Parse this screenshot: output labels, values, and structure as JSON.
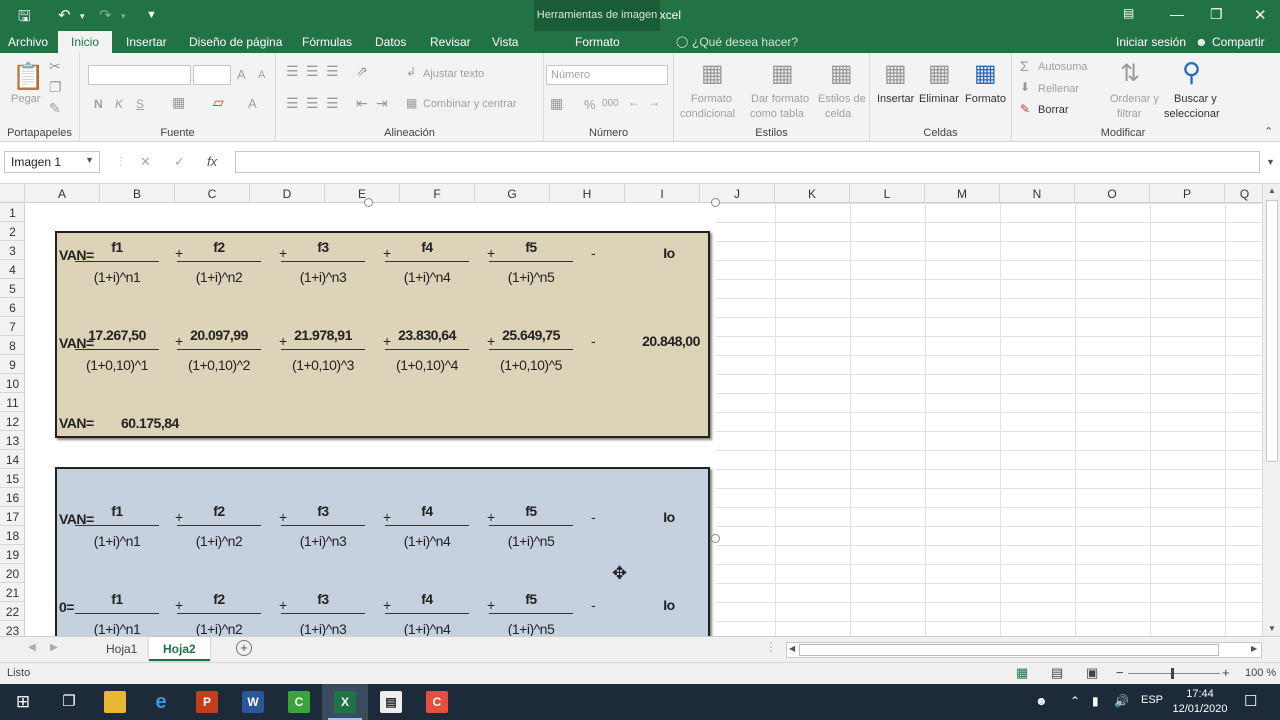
{
  "window": {
    "title": "van y tir - Excel",
    "tools_context": "Herramientas de imagen",
    "undo_icon": "undo-icon",
    "colors": {
      "brand": "#217346"
    }
  },
  "tabs": {
    "items": [
      "Archivo",
      "Inicio",
      "Insertar",
      "Diseño de página",
      "Fórmulas",
      "Datos",
      "Revisar",
      "Vista"
    ],
    "format_tab": "Formato",
    "tell_me": "¿Qué desea hacer?",
    "sign_in": "Iniciar sesión",
    "share": "Compartir"
  },
  "ribbon": {
    "clipboard": {
      "label": "Portapapeles",
      "paste": "Pegar"
    },
    "font": {
      "label": "Fuente",
      "bold": "N",
      "italic": "K",
      "underline": "S",
      "grow": "A",
      "shrink": "A"
    },
    "alignment": {
      "label": "Alineación",
      "wrap": "Ajustar texto",
      "merge": "Combinar y centrar"
    },
    "number": {
      "label": "Número",
      "format": "Número",
      "percent": "%",
      "thousands": "000"
    },
    "styles": {
      "label": "Estilos",
      "conditional_1": "Formato",
      "conditional_2": "condicional",
      "table_1": "Dar formato",
      "table_2": "como tabla",
      "cell_1": "Estilos de",
      "cell_2": "celda"
    },
    "cells": {
      "label": "Celdas",
      "insert": "Insertar",
      "delete": "Eliminar",
      "format": "Formato"
    },
    "editing": {
      "label": "Modificar",
      "autosum": "Autosuma",
      "fill": "Rellenar",
      "clear": "Borrar",
      "sort_1": "Ordenar y",
      "sort_2": "filtrar",
      "find_1": "Buscar y",
      "find_2": "seleccionar"
    }
  },
  "formula_bar": {
    "name_box": "Imagen 1",
    "fx": "fx",
    "cancel": "✕",
    "enter": "✓",
    "value": ""
  },
  "columns": [
    "A",
    "B",
    "C",
    "D",
    "E",
    "F",
    "G",
    "H",
    "I",
    "J",
    "K",
    "L",
    "M",
    "N",
    "O",
    "P",
    "Q"
  ],
  "rows": [
    "1",
    "2",
    "3",
    "4",
    "5",
    "6",
    "7",
    "8",
    "9",
    "10",
    "11",
    "12",
    "13",
    "14",
    "15",
    "16",
    "17",
    "18",
    "19",
    "20",
    "21",
    "22",
    "23"
  ],
  "image": {
    "box1": {
      "row1": {
        "lhs": "VAN=",
        "nums": [
          "f1",
          "f2",
          "f3",
          "f4",
          "f5"
        ],
        "dens": [
          "(1+i)^n1",
          "(1+i)^n2",
          "(1+i)^n3",
          "(1+i)^n4",
          "(1+i)^n5"
        ],
        "ops": [
          "+",
          "+",
          "+",
          "+",
          "-"
        ],
        "io": "Io"
      },
      "row2": {
        "lhs": "VAN=",
        "nums": [
          "17.267,50",
          "20.097,99",
          "21.978,91",
          "23.830,64",
          "25.649,75"
        ],
        "dens": [
          "(1+0,10)^1",
          "(1+0,10)^2",
          "(1+0,10)^3",
          "(1+0,10)^4",
          "(1+0,10)^5"
        ],
        "ops": [
          "+",
          "+",
          "+",
          "+",
          "-"
        ],
        "io": "20.848,00"
      },
      "result": {
        "lhs": "VAN=",
        "value": "60.175,84"
      },
      "background": "#ddd3b8"
    },
    "box2": {
      "row1": {
        "lhs": "VAN=",
        "nums": [
          "f1",
          "f2",
          "f3",
          "f4",
          "f5"
        ],
        "dens": [
          "(1+i)^n1",
          "(1+i)^n2",
          "(1+i)^n3",
          "(1+i)^n4",
          "(1+i)^n5"
        ],
        "ops": [
          "+",
          "+",
          "+",
          "+",
          "-"
        ],
        "io": "Io"
      },
      "row2": {
        "lhs": "0=",
        "nums": [
          "f1",
          "f2",
          "f3",
          "f4",
          "f5"
        ],
        "dens": [
          "(1+i)^n1",
          "(1+i)^n2",
          "(1+i)^n3",
          "(1+i)^n4",
          "(1+i)^n5"
        ],
        "ops": [
          "+",
          "+",
          "+",
          "+",
          "-"
        ],
        "io": "Io"
      },
      "background": "#c6d1e0"
    }
  },
  "sheets": {
    "items": [
      "Hoja1",
      "Hoja2"
    ],
    "active": "Hoja2"
  },
  "status": {
    "ready": "Listo",
    "zoom": "100 %"
  },
  "taskbar": {
    "apps": [
      "start-icon",
      "taskview-icon",
      "file-explorer-icon",
      "edge-icon",
      "powerpoint-icon",
      "word-icon",
      "camtasia-icon",
      "excel-icon",
      "clapper-icon",
      "camtasia-recorder-icon"
    ],
    "language": "ESP",
    "time": "17:44",
    "date": "12/01/2020"
  }
}
